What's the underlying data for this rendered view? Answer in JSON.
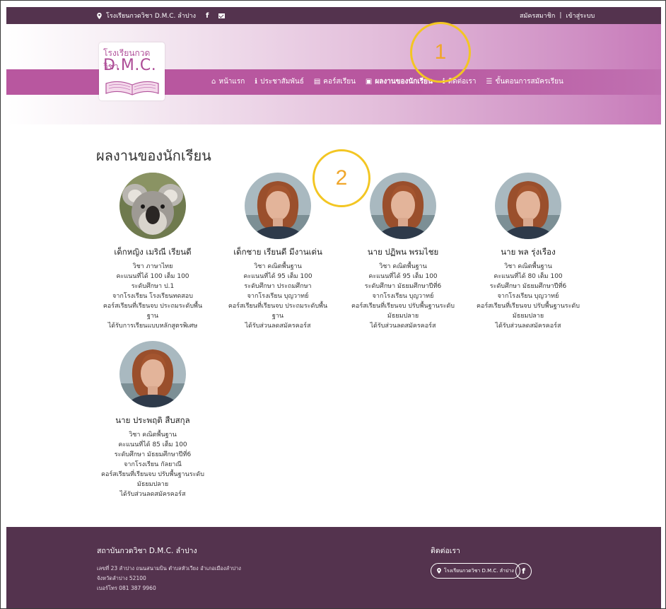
{
  "topbar": {
    "school_link": "โรงเรียนกวดวิชา D.M.C. ลำปาง",
    "register": "สมัครสมาชิก",
    "separator": "|",
    "login": "เข้าสู่ระบบ",
    "facebook_glyph": "f"
  },
  "logo": {
    "line1": "โรงเรียนกวดวิชา",
    "line2": "D.M.C."
  },
  "nav": {
    "items": [
      {
        "icon": "⌂",
        "label": "หน้าแรก"
      },
      {
        "icon": "ℹ",
        "label": "ประชาสัมพันธ์"
      },
      {
        "icon": "▤",
        "label": "คอร์สเรียน"
      },
      {
        "icon": "▣",
        "label": "ผลงานของนักเรียน"
      },
      {
        "icon": "ℹ",
        "label": "ติดต่อเรา"
      },
      {
        "icon": "☰",
        "label": "ขั้นตอนการสมัครเรียน"
      }
    ]
  },
  "annotations": [
    "1",
    "2"
  ],
  "section": {
    "title": "ผลงานของนักเรียน"
  },
  "students": [
    {
      "name": "เด็กหญิง เมริณี เรียนดี",
      "lines": [
        "วิชา ภาษาไทย",
        "คะแนนที่ได้ 100 เต็ม 100",
        "ระดับศึกษา ป.1",
        "จากโรงเรียน โรงเรียนทดสอบ",
        "คอร์สเรียนที่เรียนจบ ประถมระดับพื้น",
        "ฐาน",
        "ได้รับการเรียนแบบหลักสูตรพิเศษ"
      ]
    },
    {
      "name": "เด็กชาย เรียนดี มีงานเด่น",
      "lines": [
        "วิชา คณิตพื้นฐาน",
        "คะแนนที่ได้ 95 เต็ม 100",
        "ระดับศึกษา ประถมศึกษา",
        "จากโรงเรียน บุญวาทย์",
        "คอร์สเรียนที่เรียนจบ ประถมระดับพื้น",
        "ฐาน",
        "ได้รับส่วนลดสมัครคอร์ส"
      ]
    },
    {
      "name": "นาย ปฏิพน พรมไชย",
      "lines": [
        "วิชา คณิตพื้นฐาน",
        "คะแนนที่ได้ 95 เต็ม 100",
        "ระดับศึกษา มัธยมศึกษาปีที่6",
        "จากโรงเรียน บุญวาทย์",
        "คอร์สเรียนที่เรียนจบ ปรับพื้นฐานระดับ",
        "มัธยมปลาย",
        "ได้รับส่วนลดสมัครคอร์ส"
      ]
    },
    {
      "name": "นาย พล รุ่งเรือง",
      "lines": [
        "วิชา คณิตพื้นฐาน",
        "คะแนนที่ได้ 80 เต็ม 100",
        "ระดับศึกษา มัธยมศึกษาปีที่6",
        "จากโรงเรียน บุญวาทย์",
        "คอร์สเรียนที่เรียนจบ ปรับพื้นฐานระดับ",
        "มัธยมปลาย",
        "ได้รับส่วนลดสมัครคอร์ส"
      ]
    },
    {
      "name": "นาย ประพฤติ สืบสกุล",
      "lines": [
        "วิชา คณิตพื้นฐาน",
        "คะแนนที่ได้ 85 เต็ม 100",
        "ระดับศึกษา มัธยมศึกษาปีที่6",
        "จากโรงเรียน กัลยาณี",
        "คอร์สเรียนที่เรียนจบ ปรับพื้นฐานระดับ",
        "มัธยมปลาย",
        "ได้รับส่วนลดสมัครคอร์ส"
      ]
    }
  ],
  "footer": {
    "institute_title": "สถาบันกวดวิชา D.M.C. ลำปาง",
    "address_lines": [
      "เลขที่ 23 ลำปาง ถนนสนามบิน ตำบลหัวเวียง อำเภอเมืองลำปาง",
      "จังหวัดลำปาง 52100",
      "เบอร์โทร 081 387 9960"
    ],
    "contact_title": "ติดต่อเรา",
    "contact_pill": "โรงเรียนกวดวิชา D.M.C. ลำปาง",
    "facebook_glyph": "f"
  },
  "colors": {
    "topbar": "#54334e",
    "nav": "#b8579f",
    "footer": "#54334e",
    "annotation": "#f3c623"
  }
}
